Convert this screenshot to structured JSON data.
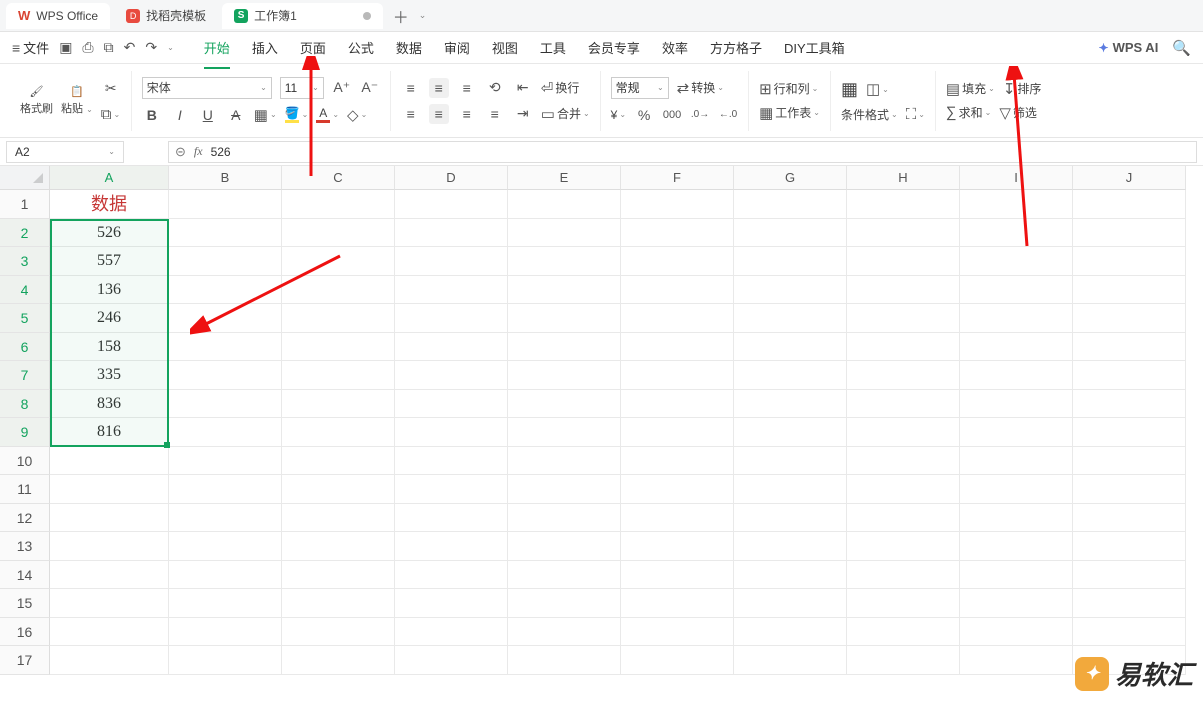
{
  "titlebar": {
    "app_name": "WPS Office",
    "find_template": "找稻壳模板",
    "workbook": "工作簿1"
  },
  "menubar": {
    "file": "文件",
    "items": [
      "开始",
      "插入",
      "页面",
      "公式",
      "数据",
      "审阅",
      "视图",
      "工具",
      "会员专享",
      "效率",
      "方方格子",
      "DIY工具箱"
    ],
    "ai": "WPS AI"
  },
  "ribbon": {
    "format_painter": "格式刷",
    "paste": "粘贴",
    "font_name": "宋体",
    "font_size": "11",
    "wrap": "换行",
    "merge": "合并",
    "number_format": "常规",
    "transform": "转换",
    "rowcol": "行和列",
    "worksheet": "工作表",
    "cond_format": "条件格式",
    "fill": "填充",
    "sum": "求和",
    "sort": "排序",
    "filter": "筛选"
  },
  "namebox": "A2",
  "formula": "526",
  "columns": [
    "A",
    "B",
    "C",
    "D",
    "E",
    "F",
    "G",
    "H",
    "I",
    "J"
  ],
  "rows": [
    "1",
    "2",
    "3",
    "4",
    "5",
    "6",
    "7",
    "8",
    "9",
    "10",
    "11",
    "12",
    "13",
    "14",
    "15",
    "16",
    "17"
  ],
  "cell_header": "数据",
  "column_a": [
    "526",
    "557",
    "136",
    "246",
    "158",
    "335",
    "836",
    "816"
  ],
  "watermark": "易软汇",
  "chart_data": {
    "type": "table",
    "columns": [
      "数据"
    ],
    "values": [
      526,
      557,
      136,
      246,
      158,
      335,
      836,
      816
    ]
  }
}
